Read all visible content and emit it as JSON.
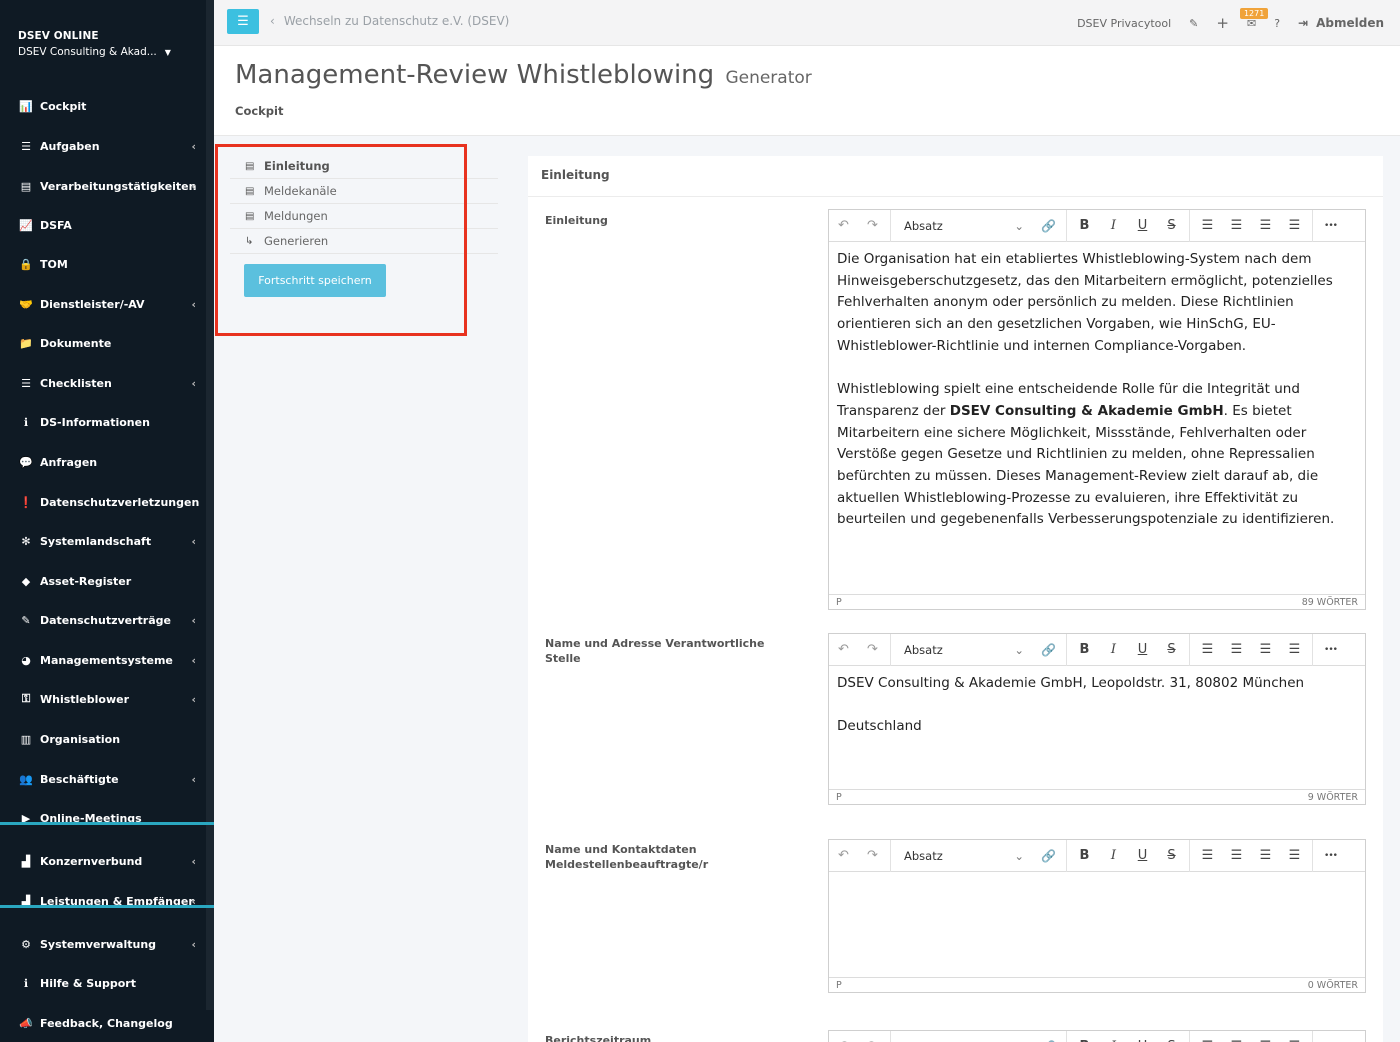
{
  "sidebar": {
    "brand_title": "DSEV ONLINE",
    "brand_subtitle": "DSEV Consulting & Akad...",
    "items": [
      {
        "label": "Cockpit",
        "icon": "chart-icon",
        "glyph": "📊",
        "chevron": false
      },
      {
        "label": "Aufgaben",
        "icon": "list-icon",
        "glyph": "☰",
        "chevron": true
      },
      {
        "label": "Verarbeitungstätigkeiten",
        "icon": "table-icon",
        "glyph": "▤",
        "chevron": true
      },
      {
        "label": "DSFA",
        "icon": "line-chart-icon",
        "glyph": "📈",
        "chevron": false
      },
      {
        "label": "TOM",
        "icon": "lock-icon",
        "glyph": "🔒",
        "chevron": false
      },
      {
        "label": "Dienstleister/-AV",
        "icon": "handshake-icon",
        "glyph": "🤝",
        "chevron": true
      },
      {
        "label": "Dokumente",
        "icon": "folder-icon",
        "glyph": "📁",
        "chevron": false
      },
      {
        "label": "Checklisten",
        "icon": "checklist-icon",
        "glyph": "☰",
        "chevron": true
      },
      {
        "label": "DS-Informationen",
        "icon": "info-icon",
        "glyph": "ℹ",
        "chevron": false
      },
      {
        "label": "Anfragen",
        "icon": "comments-icon",
        "glyph": "💬",
        "chevron": false
      },
      {
        "label": "Datenschutzverletzungen",
        "icon": "alert-icon",
        "glyph": "❗",
        "chevron": false
      },
      {
        "label": "Systemlandschaft",
        "icon": "network-icon",
        "glyph": "✻",
        "chevron": true
      },
      {
        "label": "Asset-Register",
        "icon": "gem-icon",
        "glyph": "◆",
        "chevron": false
      },
      {
        "label": "Datenschutzverträge",
        "icon": "signature-icon",
        "glyph": "✎",
        "chevron": true
      },
      {
        "label": "Managementsysteme",
        "icon": "dashboard-icon",
        "glyph": "◕",
        "chevron": true
      },
      {
        "label": "Whistleblower",
        "icon": "key-icon",
        "glyph": "⚿",
        "chevron": true
      },
      {
        "label": "Organisation",
        "icon": "building-icon",
        "glyph": "▥",
        "chevron": false
      },
      {
        "label": "Beschäftigte",
        "icon": "users-icon",
        "glyph": "👥",
        "chevron": true
      },
      {
        "label": "Online-Meetings",
        "icon": "video-icon",
        "glyph": "▶",
        "chevron": false
      },
      {
        "label": "Konzernverbund",
        "icon": "industry-icon",
        "glyph": "▟",
        "chevron": true
      },
      {
        "label": "Leistungen & Empfänger",
        "icon": "industry-icon",
        "glyph": "▟",
        "chevron": true
      },
      {
        "label": "Systemverwaltung",
        "icon": "cogs-icon",
        "glyph": "⚙",
        "chevron": true
      },
      {
        "label": "Hilfe & Support",
        "icon": "info-icon",
        "glyph": "ℹ",
        "chevron": false
      },
      {
        "label": "Feedback, Changelog",
        "icon": "megaphone-icon",
        "glyph": "📣",
        "chevron": false
      }
    ]
  },
  "topbar": {
    "back_label": "Wechseln zu Datenschutz e.V. (DSEV)",
    "tool_label": "DSEV Privacytool",
    "mail_badge": "1271",
    "logout_label": "Abmelden"
  },
  "header": {
    "title": "Management-Review Whistleblowing",
    "title_small": "Generator",
    "subtitle": "Cockpit"
  },
  "steps": {
    "items": [
      {
        "label": "Einleitung",
        "active": true,
        "glyph": "▤"
      },
      {
        "label": "Meldekanäle",
        "active": false,
        "glyph": "▤"
      },
      {
        "label": "Meldungen",
        "active": false,
        "glyph": "▤"
      },
      {
        "label": "Generieren",
        "active": false,
        "glyph": "↳"
      }
    ],
    "save_label": "Fortschritt speichern"
  },
  "card": {
    "heading": "Einleitung",
    "format_label": "Absatz",
    "fields": [
      {
        "label": "Einleitung",
        "paragraphs": [
          "Die Organisation hat ein etabliertes Whistleblowing-System nach dem Hinweisgeberschutzgesetz, das den Mitarbeitern ermöglicht, potenzielles Fehlverhalten anonym oder persönlich zu melden. Diese Richtlinien orientieren sich an den gesetzlichen Vorgaben, wie HinSchG, EU-Whistleblower-Richtlinie und internen Compliance-Vorgaben.",
          "Whistleblowing spielt eine entscheidende Rolle für die Integrität und Transparenz der ",
          "DSEV Consulting & Akademie GmbH",
          ". Es bietet Mitarbeitern eine sichere Möglichkeit, Missstände, Fehlverhalten oder Verstöße gegen Gesetze und Richtlinien zu melden, ohne Repressalien befürchten zu müssen. Dieses Management-Review zielt darauf ab, die aktuellen Whistleblowing-Prozesse zu evaluieren, ihre Effektivität zu beurteilen und gegebenenfalls Verbesserungspotenziale zu identifizieren."
        ],
        "status_left": "P",
        "status_right": "89 WÖRTER"
      },
      {
        "label": "Name und Adresse Verantwortliche Stelle",
        "paragraphs": [
          "DSEV Consulting & Akademie GmbH, Leopoldstr. 31, 80802 München",
          "Deutschland"
        ],
        "status_left": "P",
        "status_right": "9 WÖRTER"
      },
      {
        "label": "Name und Kontaktdaten Meldestellenbeauftragte/r",
        "paragraphs": [],
        "status_left": "P",
        "status_right": "0 WÖRTER"
      },
      {
        "label": "Berichtszeitraum"
      }
    ]
  }
}
